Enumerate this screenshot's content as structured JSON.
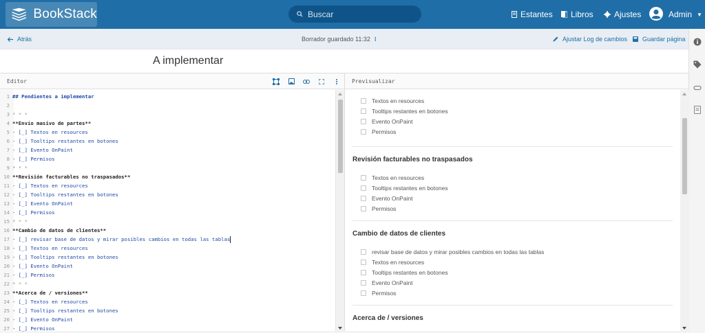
{
  "app": {
    "name": "BookStack"
  },
  "search": {
    "placeholder": "Buscar"
  },
  "nav": {
    "shelves": "Estantes",
    "books": "Libros",
    "settings": "Ajustes",
    "user": "Admin"
  },
  "toolbar": {
    "back": "Atrás",
    "draft_status": "Borrador guardado 11:32",
    "changelog": "Ajustar Log de cambios",
    "save": "Guardar página"
  },
  "page": {
    "title": "A implementar"
  },
  "editor": {
    "label": "Editor",
    "lines": [
      {
        "n": "1",
        "t": "## Pendientes a implementar",
        "k": "h"
      },
      {
        "n": "2",
        "t": "",
        "k": ""
      },
      {
        "n": "3",
        "t": "* * *",
        "k": "hr"
      },
      {
        "n": "4",
        "t": "**Envío masivo de partes**",
        "k": "b"
      },
      {
        "n": "5",
        "t": "- [_] Textos en resources",
        "k": "list"
      },
      {
        "n": "6",
        "t": "- [_] Tooltips restantes en botones",
        "k": "list"
      },
      {
        "n": "7",
        "t": "- [_] Evento OnPaint",
        "k": "list"
      },
      {
        "n": "8",
        "t": "- [_] Permisos",
        "k": "list"
      },
      {
        "n": "9",
        "t": "* * *",
        "k": "hr"
      },
      {
        "n": "10",
        "t": "**Revisión facturables no traspasados**",
        "k": "b"
      },
      {
        "n": "11",
        "t": "- [_] Textos en resources",
        "k": "list"
      },
      {
        "n": "12",
        "t": "- [_] Tooltips restantes en botones",
        "k": "list"
      },
      {
        "n": "13",
        "t": "- [_] Evento OnPaint",
        "k": "list"
      },
      {
        "n": "14",
        "t": "- [_] Permisos",
        "k": "list"
      },
      {
        "n": "15",
        "t": "* * *",
        "k": "hr"
      },
      {
        "n": "16",
        "t": "**Cambio de datos de clientes**",
        "k": "b"
      },
      {
        "n": "17",
        "t": "- [_] revisar base de datos y mirar posibles cambios en todas las tablas",
        "k": "list"
      },
      {
        "n": "18",
        "t": "- [_] Textos en resources",
        "k": "list"
      },
      {
        "n": "19",
        "t": "- [_] Tooltips restantes en botones",
        "k": "list"
      },
      {
        "n": "20",
        "t": "- [_] Evento OnPaint",
        "k": "list"
      },
      {
        "n": "21",
        "t": "- [_] Permisos",
        "k": "list"
      },
      {
        "n": "22",
        "t": "* * *",
        "k": "hr"
      },
      {
        "n": "23",
        "t": "**Acerca de / versiones**",
        "k": "b"
      },
      {
        "n": "24",
        "t": "- [_] Textos en resources",
        "k": "list"
      },
      {
        "n": "25",
        "t": "- [_] Tooltips restantes en botones",
        "k": "list"
      },
      {
        "n": "26",
        "t": "- [_] Evento OnPaint",
        "k": "list"
      },
      {
        "n": "27",
        "t": "- [_] Permisos",
        "k": "list"
      }
    ]
  },
  "preview": {
    "label": "Previsualizar",
    "top_items": [
      "Textos en resources",
      "Tooltips restantes en botones",
      "Evento OnPaint",
      "Permisos"
    ],
    "sections": [
      {
        "heading": "Revisión facturables no traspasados",
        "items": [
          "Textos en resources",
          "Tooltips restantes en botones",
          "Evento OnPaint",
          "Permisos"
        ]
      },
      {
        "heading": "Cambio de datos de clientes",
        "items": [
          "revisar base de datos y mirar posibles cambios en todas las tablas",
          "Textos en resources",
          "Tooltips restantes en botones",
          "Evento OnPaint",
          "Permisos"
        ]
      },
      {
        "heading": "Acerca de / versiones",
        "items": []
      }
    ]
  },
  "colors": {
    "header": "#206ea7",
    "accent": "#206ea7",
    "search_bg": "#0f5489"
  }
}
